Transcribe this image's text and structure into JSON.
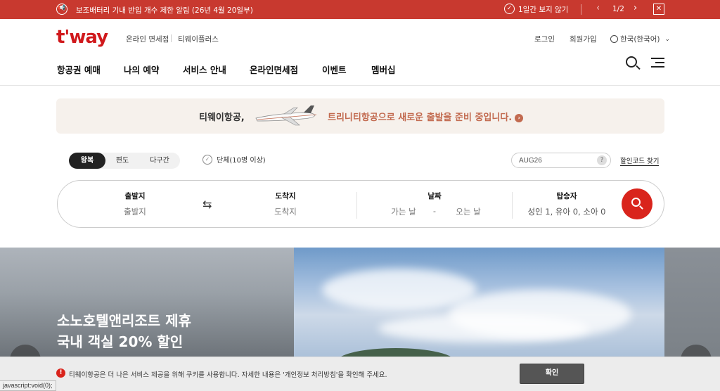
{
  "notice": {
    "message": "보조배터리 기내 반입 개수 제한 알림 (26년 4월 20일부)",
    "hide_label": "1일간 보지 않기",
    "page": "1/2"
  },
  "header": {
    "logo": "t'way",
    "sub_links": [
      "온라인 면세점",
      "티웨이플러스"
    ],
    "login": "로그인",
    "signup": "회원가입",
    "language": "한국(한국어)"
  },
  "main_nav": [
    "항공권 예매",
    "나의 예약",
    "서비스 안내",
    "온라인면세점",
    "이벤트",
    "멤버십"
  ],
  "banner": {
    "left_text": "티웨이항공,",
    "right_text": "트리니티항공으로 새로운 출발을 준비 중입니다."
  },
  "booking": {
    "trip_types": [
      "왕복",
      "편도",
      "다구간"
    ],
    "group_label": "단체(10명 이상)",
    "promo_code": "AUG26",
    "find_code": "할인코드 찾기",
    "fields": {
      "origin_label": "출발지",
      "origin_value": "출발지",
      "dest_label": "도착지",
      "dest_value": "도착지",
      "date_label": "날짜",
      "depart_value": "가는 날",
      "date_sep": "-",
      "return_value": "오는 날",
      "pax_label": "탑승자",
      "pax_value": "성인 1, 유아 0, 소아 0"
    }
  },
  "hero": {
    "line1": "소노호텔앤리조트 제휴",
    "line2": "국내 객실 20% 할인"
  },
  "cookie": {
    "message": "티웨이항공은 더 나은 서비스 제공을 위해 쿠키를 사용합니다. 자세한 내용은 '개인정보 처리방침'을 확인해 주세요.",
    "confirm": "확인"
  },
  "status_bar": "javascript:void(0);",
  "colors": {
    "brand_red": "#c8392f",
    "search_red": "#d9241c",
    "banner_accent": "#c26a4f"
  }
}
